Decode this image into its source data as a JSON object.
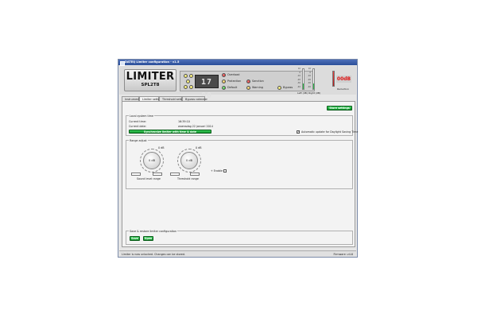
{
  "window": {
    "title": "DATEQ Limiter configuration - v1.5"
  },
  "header": {
    "logo_title": "LIMITER",
    "logo_model": "SPL2T8",
    "display_value": "17 00",
    "status_labels": {
      "overload": "Overload",
      "protection": "Protection",
      "default": "Default",
      "sanction": "Sanction",
      "warning": "Warning",
      "bypass": "Bypass"
    },
    "meters": {
      "scale": [
        "10",
        "0",
        "-10",
        "-20",
        "-30",
        "-40"
      ],
      "left_caption": "Left (dB)",
      "right_caption": "Right (dB)",
      "left_level": 0.3,
      "right_level": 0.3
    },
    "reduction_value": "00dB",
    "reduction_caption": "Reduction"
  },
  "tabs": [
    {
      "label": "Instrument",
      "active": false
    },
    {
      "label": "Limiter settings",
      "active": true
    },
    {
      "label": "Threshold settings",
      "active": false
    },
    {
      "label": "Bypass calender",
      "active": false
    }
  ],
  "content": {
    "store_button": "Store settings",
    "local_time": {
      "group_label": "Local system time",
      "current_time_label": "Current time:",
      "current_time_value": "16:39:10",
      "current_date_label": "Current date:",
      "current_date_value": "woensdag 22 januari 2014",
      "sync_button": "Synchronize limiter with time & date",
      "dst_label": "Automatic update for Daylight Saving Time",
      "dst_checked": true
    },
    "range": {
      "group_label": "Range adjust",
      "knob1_top": "0 dB",
      "knob1_value": "0 dB",
      "knob2_top": "0 dB",
      "knob2_value": "0 dB",
      "knob1_caption": "Sound level range",
      "knob2_caption": "Threshold range",
      "enable_label": "+ Enable",
      "enable_checked": false
    },
    "save_restore": {
      "group_label": "Save & restore limiter configuration",
      "save_button": "Save",
      "open_button": "Open"
    }
  },
  "statusbar": {
    "left_text": "Limiter is now unlocked. Changes can be stored.",
    "right_text": "Firmware: v4.6"
  }
}
